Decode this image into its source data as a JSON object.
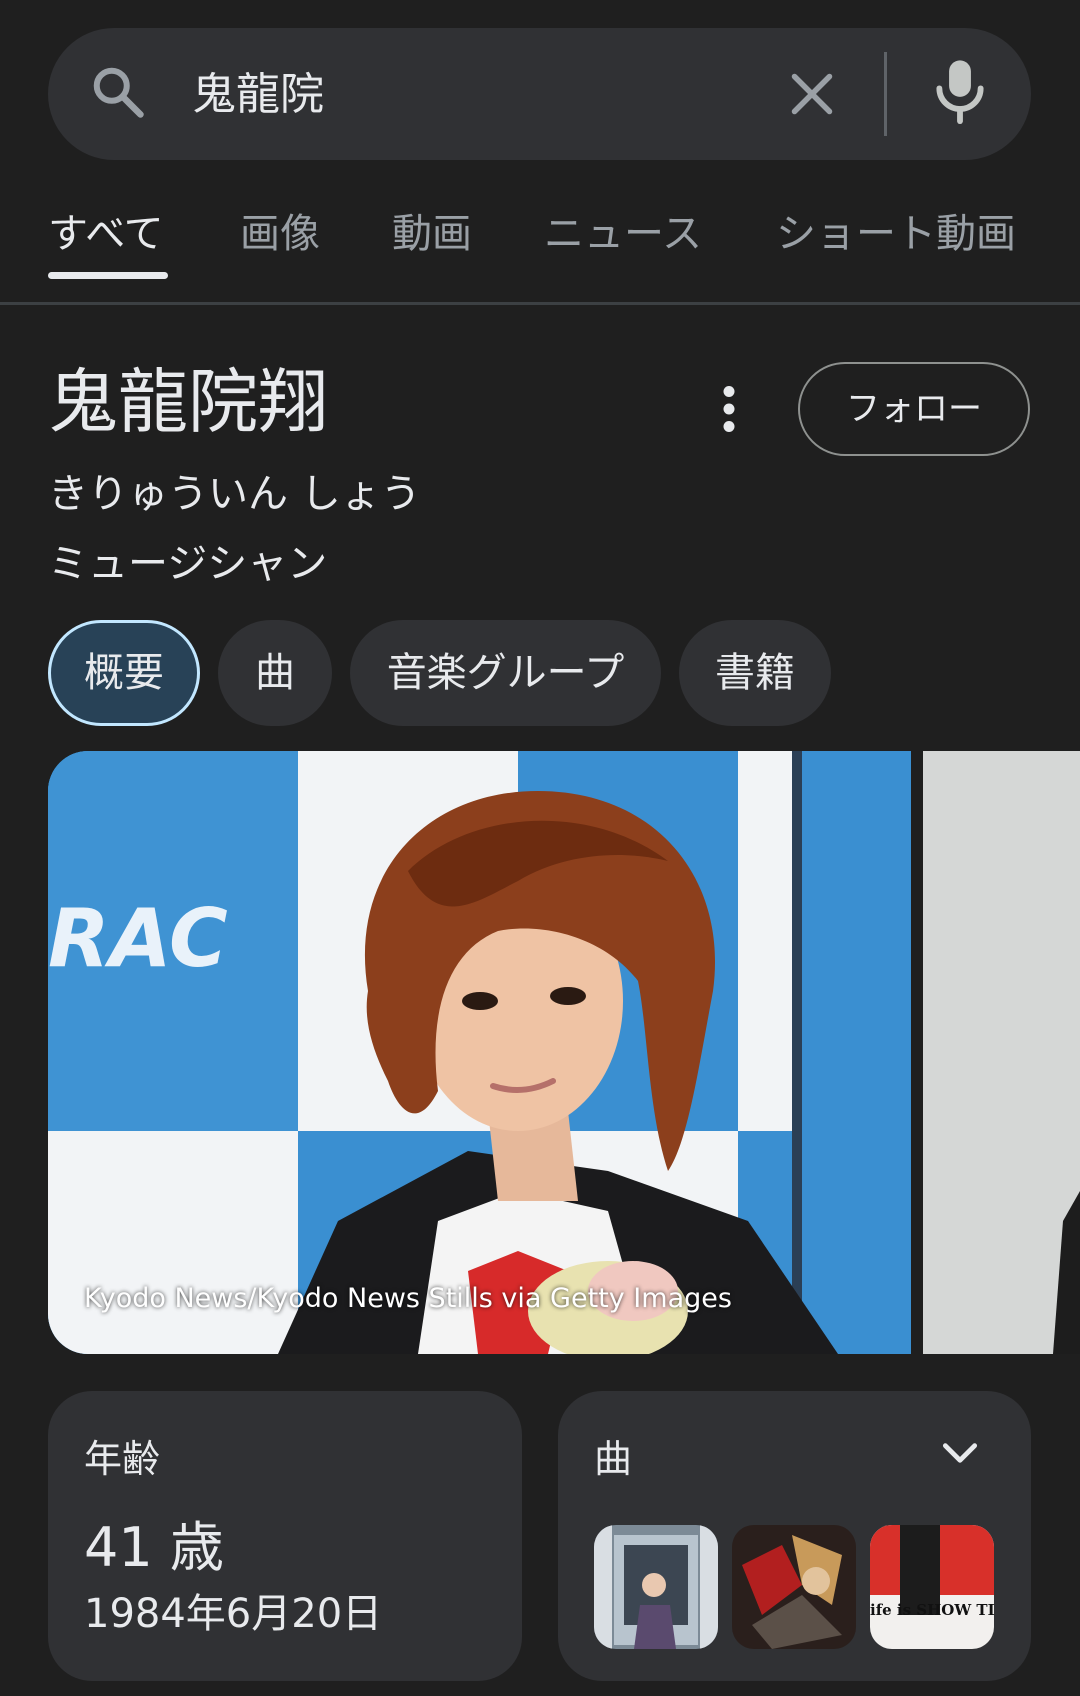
{
  "search": {
    "query": "鬼龍院"
  },
  "tabs": [
    {
      "label": "すべて",
      "active": true
    },
    {
      "label": "画像",
      "active": false
    },
    {
      "label": "動画",
      "active": false
    },
    {
      "label": "ニュース",
      "active": false
    },
    {
      "label": "ショート動画",
      "active": false
    }
  ],
  "panel": {
    "title": "鬼龍院翔",
    "reading": "きりゅういん しょう",
    "type": "ミュージシャン",
    "follow_label": "フォロー"
  },
  "chips": [
    {
      "label": "概要",
      "selected": true
    },
    {
      "label": "曲",
      "selected": false
    },
    {
      "label": "音楽グループ",
      "selected": false
    },
    {
      "label": "書籍",
      "selected": false
    }
  ],
  "image": {
    "credit": "Kyodo News/Kyodo News Stills via Getty Images",
    "backdrop_logo": "RAC"
  },
  "age_card": {
    "label": "年齢",
    "value": "41 歳",
    "birthdate": "1984年6月20日"
  },
  "songs_card": {
    "label": "曲",
    "thumb_caption": "ife is SHOW TIM"
  },
  "colors": {
    "background": "#1f1f1f",
    "surface": "#303134",
    "selected_chip": "#284257",
    "selected_chip_border": "#c2e7ff",
    "text_primary": "#e8eaed",
    "text_secondary": "#9aa0a6"
  }
}
